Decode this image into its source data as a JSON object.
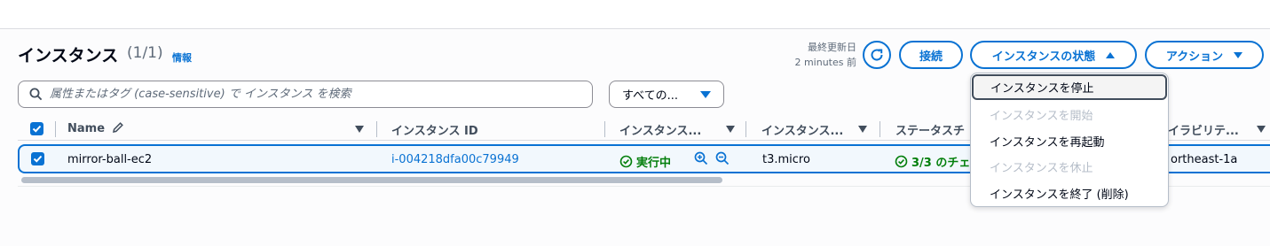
{
  "header": {
    "title": "インスタンス",
    "count": "(1/1)",
    "info_link": "情報",
    "last_updated_label": "最終更新日",
    "last_updated_value": "2 minutes 前",
    "connect_label": "接続",
    "instance_state_label": "インスタンスの状態",
    "actions_label": "アクション"
  },
  "search": {
    "placeholder": "属性またはタグ (case-sensitive) で インスタンス を検索",
    "filter_value": "すべての..."
  },
  "table": {
    "columns": [
      "Name",
      "インスタンス ID",
      "インスタンス...",
      "インスタンス...",
      "ステータスチ",
      "イラビリテ..."
    ],
    "rows": [
      {
        "name": "mirror-ball-ec2",
        "instance_id": "i-004218dfa00c79949",
        "state": "実行中",
        "instance_type": "t3.micro",
        "status_check": "3/3 のチェ",
        "availability_zone": "ortheast-1a",
        "selected": true
      }
    ],
    "header_checkbox_checked": true
  },
  "state_menu": {
    "items": [
      {
        "label": "インスタンスを停止",
        "disabled": false,
        "highlighted": true
      },
      {
        "label": "インスタンスを開始",
        "disabled": true,
        "highlighted": false
      },
      {
        "label": "インスタンスを再起動",
        "disabled": false,
        "highlighted": false
      },
      {
        "label": "インスタンスを休止",
        "disabled": true,
        "highlighted": false
      },
      {
        "label": "インスタンスを終了 (削除)",
        "disabled": false,
        "highlighted": false
      }
    ]
  },
  "colors": {
    "accent": "#0972d3",
    "success": "#037f0c",
    "disabled": "#b6bec9"
  },
  "icons": [
    "refresh-icon",
    "search-icon",
    "edit-icon",
    "check-circle-icon",
    "zoom-in-icon",
    "zoom-out-icon",
    "caret-up-icon",
    "caret-down-icon",
    "checkbox-checked-icon"
  ]
}
